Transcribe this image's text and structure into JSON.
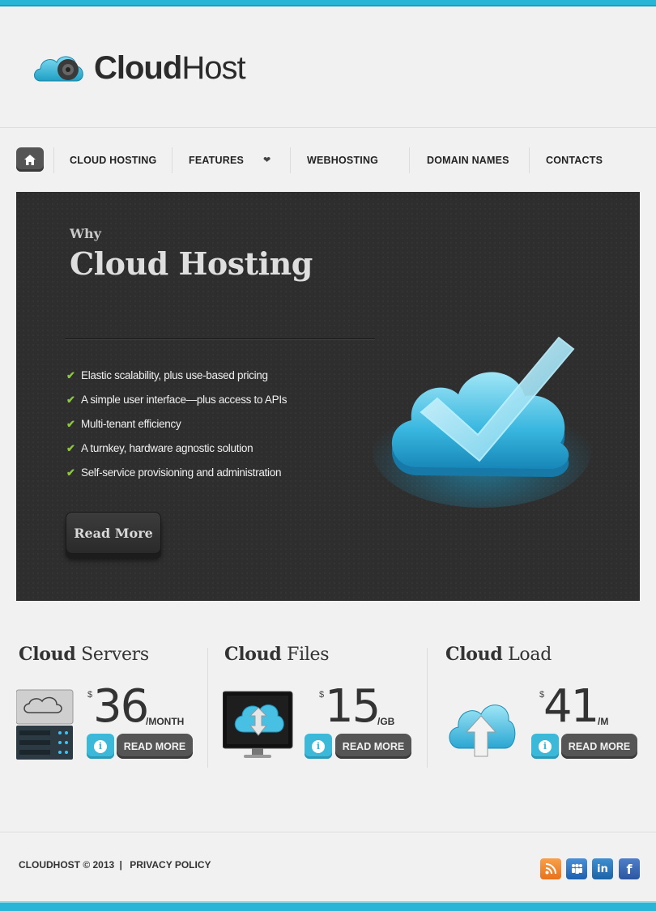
{
  "brand": {
    "name_bold": "Cloud",
    "name_light": "Host"
  },
  "nav": {
    "items": [
      "CLOUD HOSTING",
      "FEATURES",
      "WEBHOSTING",
      "DOMAIN NAMES",
      "CONTACTS"
    ],
    "features_icon": "heart-icon",
    "home_icon": "home-icon"
  },
  "hero": {
    "kicker": "Why",
    "title": "Cloud Hosting",
    "features": [
      "Elastic scalability, plus use-based pricing",
      "A simple user interface—plus access to APIs",
      "Multi-tenant efficiency",
      "A turnkey, hardware agnostic solution",
      "Self-service provisioning and administration"
    ],
    "button": "Read More"
  },
  "services": [
    {
      "title_bold": "Cloud",
      "title_light": "Servers",
      "currency": "$",
      "price": "36",
      "unit": "/MONTH",
      "button": "READ MORE",
      "icon": "server-icon"
    },
    {
      "title_bold": "Cloud",
      "title_light": "Files",
      "currency": "$",
      "price": "15",
      "unit": "/GB",
      "button": "READ MORE",
      "icon": "monitor-cloud-icon"
    },
    {
      "title_bold": "Cloud",
      "title_light": "Load",
      "currency": "$",
      "price": "41",
      "unit": "/M",
      "button": "READ MORE",
      "icon": "cloud-upload-icon"
    }
  ],
  "footer": {
    "copyright": "CLOUDHOST © 2013",
    "divider": "|",
    "privacy": "PRIVACY POLICY",
    "social": [
      "rss-icon",
      "myspace-icon",
      "linkedin-icon",
      "facebook-icon"
    ]
  },
  "colors": {
    "accent": "#29b6d6",
    "hero_bg": "#2e2e2e",
    "check": "#8dc63f"
  }
}
